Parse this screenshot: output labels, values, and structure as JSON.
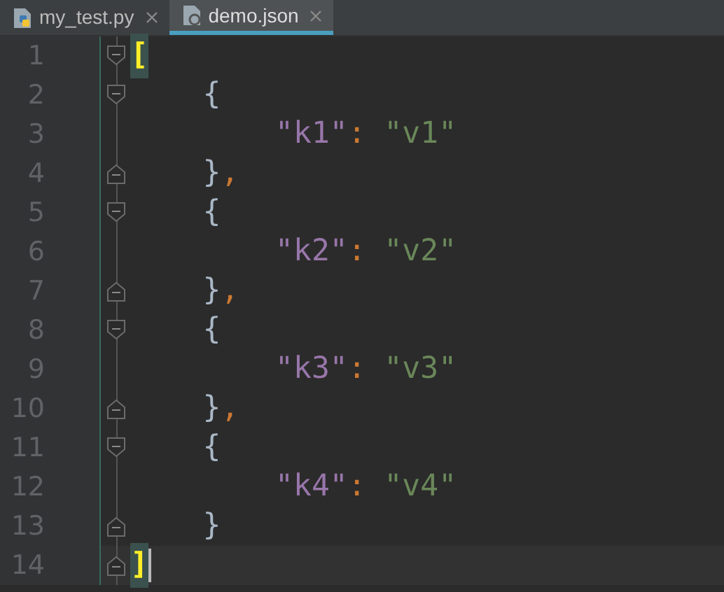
{
  "tabs": [
    {
      "label": "my_test.py",
      "selected": false
    },
    {
      "label": "demo.json",
      "selected": true
    }
  ],
  "lines": [
    {
      "number": "1",
      "kind": "fold_start",
      "current": false,
      "tokens": [
        {
          "kind": "match",
          "text": "["
        }
      ]
    },
    {
      "number": "2",
      "kind": "fold_start",
      "current": false,
      "tokens": [
        {
          "kind": "brace",
          "text": "    {"
        }
      ]
    },
    {
      "number": "3",
      "kind": "plain",
      "current": false,
      "tokens": [
        {
          "kind": "key",
          "text": "        \"k1\""
        },
        {
          "kind": "punct",
          "text": ": "
        },
        {
          "kind": "value",
          "text": "\"v1\""
        }
      ]
    },
    {
      "number": "4",
      "kind": "fold_end",
      "current": false,
      "tokens": [
        {
          "kind": "brace",
          "text": "    }"
        },
        {
          "kind": "punct",
          "text": ","
        }
      ]
    },
    {
      "number": "5",
      "kind": "fold_start",
      "current": false,
      "tokens": [
        {
          "kind": "brace",
          "text": "    {"
        }
      ]
    },
    {
      "number": "6",
      "kind": "plain",
      "current": false,
      "tokens": [
        {
          "kind": "key",
          "text": "        \"k2\""
        },
        {
          "kind": "punct",
          "text": ": "
        },
        {
          "kind": "value",
          "text": "\"v2\""
        }
      ]
    },
    {
      "number": "7",
      "kind": "fold_end",
      "current": false,
      "tokens": [
        {
          "kind": "brace",
          "text": "    }"
        },
        {
          "kind": "punct",
          "text": ","
        }
      ]
    },
    {
      "number": "8",
      "kind": "fold_start",
      "current": false,
      "tokens": [
        {
          "kind": "brace",
          "text": "    {"
        }
      ]
    },
    {
      "number": "9",
      "kind": "plain",
      "current": false,
      "tokens": [
        {
          "kind": "key",
          "text": "        \"k3\""
        },
        {
          "kind": "punct",
          "text": ": "
        },
        {
          "kind": "value",
          "text": "\"v3\""
        }
      ]
    },
    {
      "number": "10",
      "kind": "fold_end",
      "current": false,
      "tokens": [
        {
          "kind": "brace",
          "text": "    }"
        },
        {
          "kind": "punct",
          "text": ","
        }
      ]
    },
    {
      "number": "11",
      "kind": "fold_start",
      "current": false,
      "tokens": [
        {
          "kind": "brace",
          "text": "    {"
        }
      ]
    },
    {
      "number": "12",
      "kind": "plain",
      "current": false,
      "tokens": [
        {
          "kind": "key",
          "text": "        \"k4\""
        },
        {
          "kind": "punct",
          "text": ": "
        },
        {
          "kind": "value",
          "text": "\"v4\""
        }
      ]
    },
    {
      "number": "13",
      "kind": "fold_end",
      "current": false,
      "tokens": [
        {
          "kind": "brace",
          "text": "    }"
        }
      ]
    },
    {
      "number": "14",
      "kind": "fold_end",
      "current": true,
      "tokens": [
        {
          "kind": "match",
          "text": "]"
        }
      ]
    }
  ]
}
